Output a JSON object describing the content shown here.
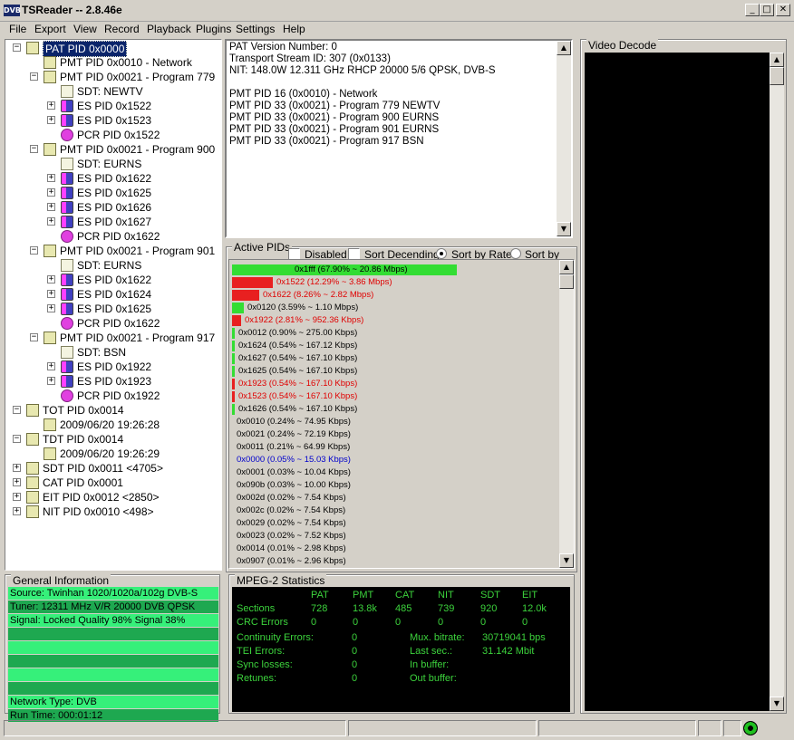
{
  "window": {
    "title": "TSReader -- 2.8.46e",
    "app_icon": "DVB",
    "minimize": "_",
    "maximize": "□",
    "close": "✕"
  },
  "menu": [
    "File",
    "Export",
    "View",
    "Record",
    "Playback",
    "Plugins",
    "Settings",
    "Help"
  ],
  "tree": [
    {
      "label": "PAT PID 0x0000",
      "icon": "pat-icon",
      "level": 0,
      "exp": "−",
      "selected": true
    },
    {
      "label": "PMT PID 0x0010 - Network",
      "icon": "pmt-icon",
      "level": 1,
      "exp": ""
    },
    {
      "label": "PMT PID 0x0021 - Program 779",
      "icon": "pmt-icon",
      "level": 1,
      "exp": "−"
    },
    {
      "label": "SDT: NEWTV",
      "icon": "sdt-icon",
      "level": 2,
      "exp": ""
    },
    {
      "label": "ES PID 0x1522",
      "icon": "es-icon",
      "level": 2,
      "exp": "+"
    },
    {
      "label": "ES PID 0x1523",
      "icon": "es-icon",
      "level": 2,
      "exp": "+"
    },
    {
      "label": "PCR PID 0x1522",
      "icon": "pcr-icon",
      "level": 2,
      "exp": ""
    },
    {
      "label": "PMT PID 0x0021 - Program 900",
      "icon": "pmt-icon",
      "level": 1,
      "exp": "−"
    },
    {
      "label": "SDT: EURNS",
      "icon": "sdt-icon",
      "level": 2,
      "exp": ""
    },
    {
      "label": "ES PID 0x1622",
      "icon": "es-icon",
      "level": 2,
      "exp": "+"
    },
    {
      "label": "ES PID 0x1625",
      "icon": "es-icon",
      "level": 2,
      "exp": "+"
    },
    {
      "label": "ES PID 0x1626",
      "icon": "es-icon",
      "level": 2,
      "exp": "+"
    },
    {
      "label": "ES PID 0x1627",
      "icon": "es-icon",
      "level": 2,
      "exp": "+"
    },
    {
      "label": "PCR PID 0x1622",
      "icon": "pcr-icon",
      "level": 2,
      "exp": ""
    },
    {
      "label": "PMT PID 0x0021 - Program 901",
      "icon": "pmt-icon",
      "level": 1,
      "exp": "−"
    },
    {
      "label": "SDT: EURNS",
      "icon": "sdt-icon",
      "level": 2,
      "exp": ""
    },
    {
      "label": "ES PID 0x1622",
      "icon": "es-icon",
      "level": 2,
      "exp": "+"
    },
    {
      "label": "ES PID 0x1624",
      "icon": "es-icon",
      "level": 2,
      "exp": "+"
    },
    {
      "label": "ES PID 0x1625",
      "icon": "es-icon",
      "level": 2,
      "exp": "+"
    },
    {
      "label": "PCR PID 0x1622",
      "icon": "pcr-icon",
      "level": 2,
      "exp": ""
    },
    {
      "label": "PMT PID 0x0021 - Program 917",
      "icon": "pmt-icon",
      "level": 1,
      "exp": "−"
    },
    {
      "label": "SDT: BSN",
      "icon": "sdt-icon",
      "level": 2,
      "exp": ""
    },
    {
      "label": "ES PID 0x1922",
      "icon": "es-icon",
      "level": 2,
      "exp": "+"
    },
    {
      "label": "ES PID 0x1923",
      "icon": "es-icon",
      "level": 2,
      "exp": "+"
    },
    {
      "label": "PCR PID 0x1922",
      "icon": "pcr-icon",
      "level": 2,
      "exp": ""
    },
    {
      "label": "TOT PID 0x0014",
      "icon": "tot-icon",
      "level": 0,
      "exp": "−"
    },
    {
      "label": "2009/06/20 19:26:28",
      "icon": "tot-icon",
      "level": 1,
      "exp": ""
    },
    {
      "label": "TDT PID 0x0014",
      "icon": "tdt-icon",
      "level": 0,
      "exp": "−"
    },
    {
      "label": "2009/06/20 19:26:29",
      "icon": "tdt-icon",
      "level": 1,
      "exp": ""
    },
    {
      "label": "SDT PID 0x0011 <4705>",
      "icon": "sdt-icon",
      "level": 0,
      "exp": "+"
    },
    {
      "label": "CAT PID 0x0001",
      "icon": "cat-icon",
      "level": 0,
      "exp": "+"
    },
    {
      "label": "EIT PID 0x0012 <2850>",
      "icon": "eit-icon",
      "level": 0,
      "exp": "+"
    },
    {
      "label": "NIT PID 0x0010 <498>",
      "icon": "nit-icon",
      "level": 0,
      "exp": "+"
    }
  ],
  "info_lines": [
    "PAT Version Number: 0",
    "Transport Stream ID: 307 (0x0133)",
    "NIT: 148.0W 12.311 GHz RHCP 20000 5/6 QPSK, DVB-S",
    "",
    "PMT PID 16 (0x0010) - Network",
    "PMT PID 33 (0x0021) - Program 779 NEWTV",
    "PMT PID 33 (0x0021) - Program 900 EURNS",
    "PMT PID 33 (0x0021) - Program 901 EURNS",
    "PMT PID 33 (0x0021) - Program 917 BSN"
  ],
  "active_pids": {
    "title": "Active PIDs",
    "disabled": "Disabled",
    "sort_desc": "Sort Decending",
    "sort_rate": "Sort by Rate",
    "sort_pid": "Sort by PID",
    "rows": [
      {
        "text": "0x1fff (67.90% ~ 20.86 Mbps)",
        "percent": 67.9,
        "color": "#000000",
        "bar": "#33dd33"
      },
      {
        "text": "0x1522 (12.29% ~ 3.86 Mbps)",
        "percent": 12.29,
        "color": "#e00000",
        "bar": "#e82020"
      },
      {
        "text": "0x1622 (8.26% ~ 2.82 Mbps)",
        "percent": 8.26,
        "color": "#e00000",
        "bar": "#e82020"
      },
      {
        "text": "0x0120 (3.59% ~ 1.10 Mbps)",
        "percent": 3.59,
        "color": "#000000",
        "bar": "#33dd33"
      },
      {
        "text": "0x1922 (2.81% ~ 952.36 Kbps)",
        "percent": 2.81,
        "color": "#e00000",
        "bar": "#e82020"
      },
      {
        "text": "0x0012 (0.90% ~ 275.00 Kbps)",
        "percent": 0.9,
        "color": "#000000",
        "bar": "#33dd33"
      },
      {
        "text": "0x1624 (0.54% ~ 167.12 Kbps)",
        "percent": 0.54,
        "color": "#000000",
        "bar": "#33dd33"
      },
      {
        "text": "0x1627 (0.54% ~ 167.10 Kbps)",
        "percent": 0.54,
        "color": "#000000",
        "bar": "#33dd33"
      },
      {
        "text": "0x1625 (0.54% ~ 167.10 Kbps)",
        "percent": 0.54,
        "color": "#000000",
        "bar": "#33dd33"
      },
      {
        "text": "0x1923 (0.54% ~ 167.10 Kbps)",
        "percent": 0.54,
        "color": "#e00000",
        "bar": "#e82020"
      },
      {
        "text": "0x1523 (0.54% ~ 167.10 Kbps)",
        "percent": 0.54,
        "color": "#e00000",
        "bar": "#e82020"
      },
      {
        "text": "0x1626 (0.54% ~ 167.10 Kbps)",
        "percent": 0.54,
        "color": "#000000",
        "bar": "#33dd33"
      },
      {
        "text": "0x0010 (0.24% ~ 74.95 Kbps)",
        "percent": 0.24,
        "color": "#000000",
        "bar": ""
      },
      {
        "text": "0x0021 (0.24% ~ 72.19 Kbps)",
        "percent": 0.24,
        "color": "#000000",
        "bar": ""
      },
      {
        "text": "0x0011 (0.21% ~ 64.99 Kbps)",
        "percent": 0.21,
        "color": "#000000",
        "bar": ""
      },
      {
        "text": "0x0000 (0.05% ~ 15.03 Kbps)",
        "percent": 0.05,
        "color": "#0000cc",
        "bar": ""
      },
      {
        "text": "0x0001 (0.03% ~ 10.04 Kbps)",
        "percent": 0.03,
        "color": "#000000",
        "bar": ""
      },
      {
        "text": "0x090b (0.03% ~ 10.00 Kbps)",
        "percent": 0.03,
        "color": "#000000",
        "bar": ""
      },
      {
        "text": "0x002d (0.02% ~ 7.54 Kbps)",
        "percent": 0.02,
        "color": "#000000",
        "bar": ""
      },
      {
        "text": "0x002c (0.02% ~ 7.54 Kbps)",
        "percent": 0.02,
        "color": "#000000",
        "bar": ""
      },
      {
        "text": "0x0029 (0.02% ~ 7.54 Kbps)",
        "percent": 0.02,
        "color": "#000000",
        "bar": ""
      },
      {
        "text": "0x0023 (0.02% ~ 7.52 Kbps)",
        "percent": 0.02,
        "color": "#000000",
        "bar": ""
      },
      {
        "text": "0x0014 (0.01% ~ 2.98 Kbps)",
        "percent": 0.01,
        "color": "#000000",
        "bar": ""
      },
      {
        "text": "0x0907 (0.01% ~ 2.96 Kbps)",
        "percent": 0.01,
        "color": "#000000",
        "bar": ""
      }
    ]
  },
  "video": {
    "title": "Video Decode"
  },
  "general": {
    "title": "General Information",
    "lines": [
      {
        "text": "Source: Twinhan 1020/1020a/102g DVB-S",
        "bg": "#36f07a"
      },
      {
        "text": "Tuner: 12311 MHz V/R 20000 DVB QPSK",
        "bg": "#1ea850"
      },
      {
        "text": "Signal: Locked Quality 98% Signal 38%",
        "bg": "#36f07a"
      },
      {
        "text": "",
        "bg": "#1ea850"
      },
      {
        "text": "",
        "bg": "#36f07a"
      },
      {
        "text": "",
        "bg": "#1ea850"
      },
      {
        "text": "",
        "bg": "#36f07a"
      },
      {
        "text": "",
        "bg": "#1ea850"
      },
      {
        "text": "Network Type: DVB",
        "bg": "#36f07a"
      },
      {
        "text": "Run Time: 000:01:12",
        "bg": "#1ea850"
      }
    ]
  },
  "mpeg": {
    "title": "MPEG-2 Statistics",
    "headers": [
      "PAT",
      "PMT",
      "CAT",
      "NIT",
      "SDT",
      "EIT"
    ],
    "sections_label": "Sections",
    "sections": [
      "728",
      "13.8k",
      "485",
      "739",
      "920",
      "12.0k"
    ],
    "crc_label": "CRC Errors",
    "crc": [
      "0",
      "0",
      "0",
      "0",
      "0",
      "0"
    ],
    "left": [
      [
        "Continuity Errors:",
        "0"
      ],
      [
        "TEI Errors:",
        "0"
      ],
      [
        "Sync losses:",
        "0"
      ],
      [
        "Retunes:",
        "0"
      ]
    ],
    "right": [
      [
        "Mux. bitrate:",
        "30719041 bps"
      ],
      [
        "Last sec.:",
        "31.142 Mbit"
      ],
      [
        "In buffer:",
        ""
      ],
      [
        "Out buffer:",
        ""
      ]
    ]
  }
}
